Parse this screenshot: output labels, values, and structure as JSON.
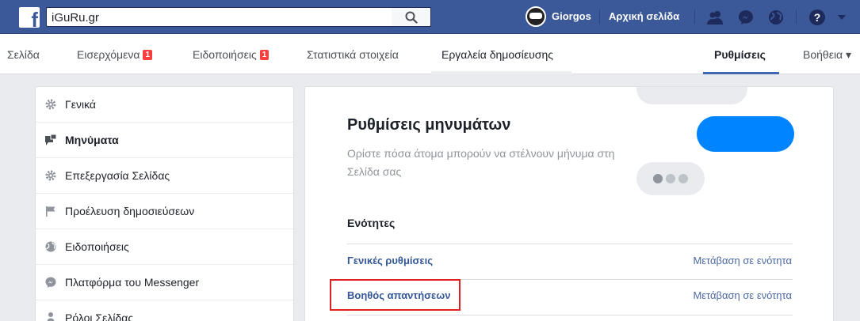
{
  "topbar": {
    "search_value": "iGuRu.gr",
    "user_name": "Giorgos",
    "home_label": "Αρχική σελίδα",
    "icons": [
      "facebook-logo",
      "search-icon",
      "friends-icon",
      "messenger-icon",
      "globe-icon",
      "help-icon",
      "caret-down-icon"
    ]
  },
  "pagenav": {
    "tabs": [
      {
        "label": "Σελίδα"
      },
      {
        "label": "Εισερχόμενα",
        "badge": "1"
      },
      {
        "label": "Ειδοποιήσεις",
        "badge": "1"
      },
      {
        "label": "Στατιστικά στοιχεία"
      },
      {
        "label": "Εργαλεία δημοσίευσης"
      },
      {
        "label": "Ρυθμίσεις"
      },
      {
        "label": "Βοήθεια ▾"
      }
    ],
    "active_tab": "Ρυθμίσεις"
  },
  "sidebar": {
    "items": [
      {
        "label": "Γενικά",
        "icon": "gear-icon"
      },
      {
        "label": "Μηνύματα",
        "icon": "messages-icon"
      },
      {
        "label": "Επεξεργασία Σελίδας",
        "icon": "gear-icon"
      },
      {
        "label": "Προέλευση δημοσιεύσεων",
        "icon": "flag-icon"
      },
      {
        "label": "Ειδοποιήσεις",
        "icon": "globe-icon"
      },
      {
        "label": "Πλατφόρμα του Messenger",
        "icon": "messenger-icon"
      },
      {
        "label": "Ρόλοι Σελίδας",
        "icon": "person-icon"
      }
    ],
    "active_item": "Μηνύματα"
  },
  "main": {
    "title": "Ρυθμίσεις μηνυμάτων",
    "description": "Ορίστε πόσα άτομα μπορούν να στέλνουν μήνυμα στη Σελίδα σας",
    "sections_heading": "Ενότητες",
    "sections": [
      {
        "label": "Γενικές ρυθμίσεις",
        "action": "Μετάβαση σε ενότητα"
      },
      {
        "label": "Βοηθός απαντήσεων",
        "action": "Μετάβαση σε ενότητα"
      }
    ]
  },
  "colors": {
    "header_blue": "#3b5998",
    "link_blue": "#365899",
    "badge_red": "#fa3e3e",
    "messenger_blue": "#0084ff",
    "highlight_red": "#e02020"
  }
}
